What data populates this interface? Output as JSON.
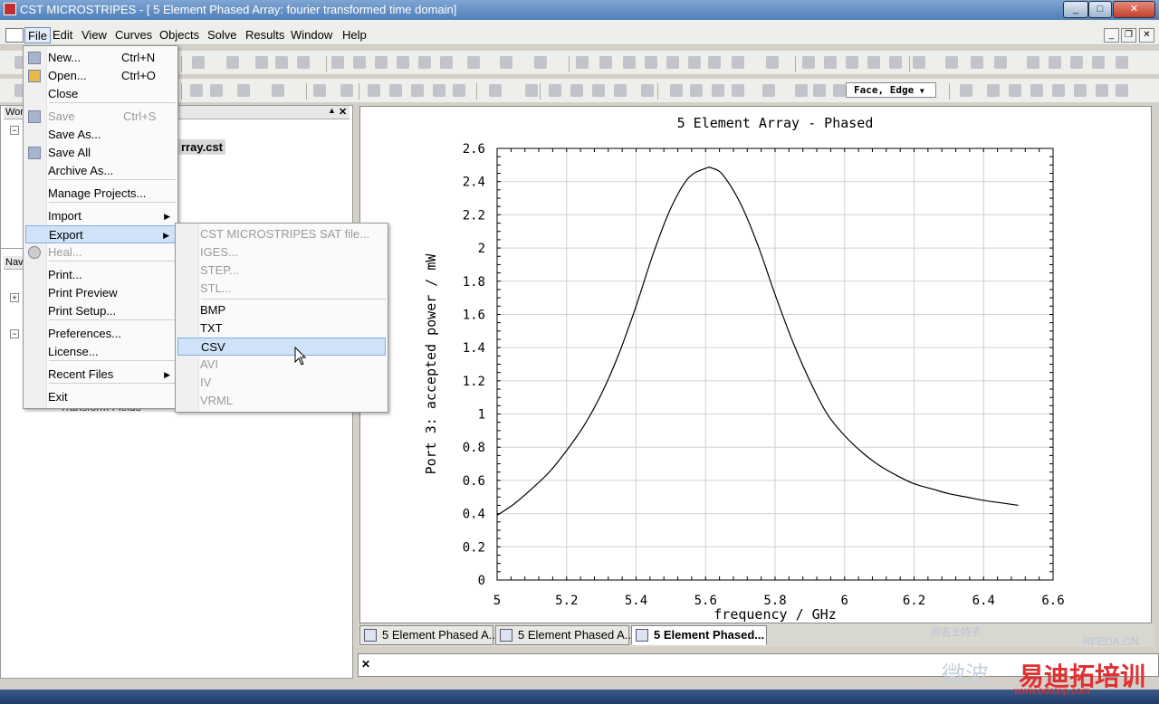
{
  "window": {
    "title": "CST MICROSTRIPES - [ 5 Element Phased Array: fourier transformed time domain]",
    "minimize": "_",
    "maximize": "□",
    "close": "✕",
    "mdi_min": "_",
    "mdi_restore": "❐",
    "mdi_close": "✕"
  },
  "menubar": {
    "items": [
      "File",
      "Edit",
      "View",
      "Curves",
      "Objects",
      "Solve",
      "Results",
      "Window",
      "Help"
    ]
  },
  "toolbar": {
    "face_edge": "Face, Edge"
  },
  "left_panel": {
    "workspace_tab": "Wor",
    "nav_tab": "Nav",
    "project_file": "rray.cst",
    "transform_item": "Transform Fields"
  },
  "file_menu": {
    "items": [
      {
        "label": "New...",
        "shortcut": "Ctrl+N",
        "disabled": false,
        "icon": "new-file-icon"
      },
      {
        "label": "Open...",
        "shortcut": "Ctrl+O",
        "disabled": false,
        "icon": "open-folder-icon"
      },
      {
        "label": "Close",
        "shortcut": "",
        "disabled": false
      },
      {
        "label": "Save",
        "shortcut": "Ctrl+S",
        "disabled": true,
        "icon": "save-icon"
      },
      {
        "label": "Save As...",
        "shortcut": "",
        "disabled": false
      },
      {
        "label": "Save All",
        "shortcut": "",
        "disabled": false,
        "icon": "save-all-icon"
      },
      {
        "label": "Archive As...",
        "shortcut": "",
        "disabled": false
      },
      {
        "label": "Manage Projects...",
        "shortcut": "",
        "disabled": false
      },
      {
        "label": "Import",
        "shortcut": "",
        "disabled": false,
        "submenu": true
      },
      {
        "label": "Export",
        "shortcut": "",
        "disabled": false,
        "submenu": true,
        "highlighted": true
      },
      {
        "label": "Heal...",
        "shortcut": "",
        "disabled": true,
        "icon": "heal-icon"
      },
      {
        "label": "Print...",
        "shortcut": "",
        "disabled": false
      },
      {
        "label": "Print Preview",
        "shortcut": "",
        "disabled": false
      },
      {
        "label": "Print Setup...",
        "shortcut": "",
        "disabled": false
      },
      {
        "label": "Preferences...",
        "shortcut": "",
        "disabled": false
      },
      {
        "label": "License...",
        "shortcut": "",
        "disabled": false
      },
      {
        "label": "Recent Files",
        "shortcut": "",
        "disabled": false,
        "submenu": true
      },
      {
        "label": "Exit",
        "shortcut": "",
        "disabled": false
      }
    ]
  },
  "export_menu": {
    "items": [
      {
        "label": "CST MICROSTRIPES SAT file...",
        "disabled": true
      },
      {
        "label": "IGES...",
        "disabled": true
      },
      {
        "label": "STEP...",
        "disabled": true
      },
      {
        "label": "STL...",
        "disabled": true
      },
      {
        "label": "BMP",
        "disabled": false
      },
      {
        "label": "TXT",
        "disabled": false
      },
      {
        "label": "CSV",
        "disabled": false,
        "highlighted": true
      },
      {
        "label": "AVI",
        "disabled": true
      },
      {
        "label": "IV",
        "disabled": true
      },
      {
        "label": "VRML",
        "disabled": true
      }
    ]
  },
  "chart_data": {
    "type": "line",
    "title": "5 Element Array - Phased",
    "xlabel": "frequency / GHz",
    "ylabel": "Port 3: accepted power / mW",
    "xlim": [
      5,
      6.6
    ],
    "ylim": [
      0,
      2.6
    ],
    "xticks": [
      "5",
      "5.2",
      "5.4",
      "5.6",
      "5.8",
      "6",
      "6.2",
      "6.4",
      "6.6"
    ],
    "yticks": [
      "0",
      "0.2",
      "0.4",
      "0.6",
      "0.8",
      "1",
      "1.2",
      "1.4",
      "1.6",
      "1.8",
      "2",
      "2.2",
      "2.4",
      "2.6"
    ],
    "grid": true,
    "series": [
      {
        "x": [
          5.0,
          5.05,
          5.1,
          5.15,
          5.2,
          5.25,
          5.3,
          5.35,
          5.4,
          5.45,
          5.5,
          5.55,
          5.6,
          5.62,
          5.65,
          5.7,
          5.75,
          5.8,
          5.85,
          5.9,
          5.95,
          6.0,
          6.05,
          6.1,
          6.15,
          6.2,
          6.25,
          6.3,
          6.35,
          6.4,
          6.45,
          6.5
        ],
        "y": [
          0.39,
          0.46,
          0.55,
          0.65,
          0.78,
          0.93,
          1.12,
          1.36,
          1.65,
          1.97,
          2.24,
          2.42,
          2.48,
          2.48,
          2.44,
          2.27,
          2.02,
          1.72,
          1.44,
          1.2,
          1.0,
          0.87,
          0.77,
          0.69,
          0.63,
          0.58,
          0.55,
          0.52,
          0.5,
          0.48,
          0.465,
          0.45
        ]
      }
    ]
  },
  "tabs": [
    {
      "label": "5 Element Phased A..."
    },
    {
      "label": "5 Element Phased A..."
    },
    {
      "label": "5 Element Phased..."
    }
  ],
  "message_bar": {
    "close": "✕"
  },
  "watermark": {
    "line1": "闻名土特子",
    "line2": "RFEDA.CN",
    "line3": "微波",
    "line4": "易迪拓培训",
    "line5": "www.edatop.com"
  }
}
